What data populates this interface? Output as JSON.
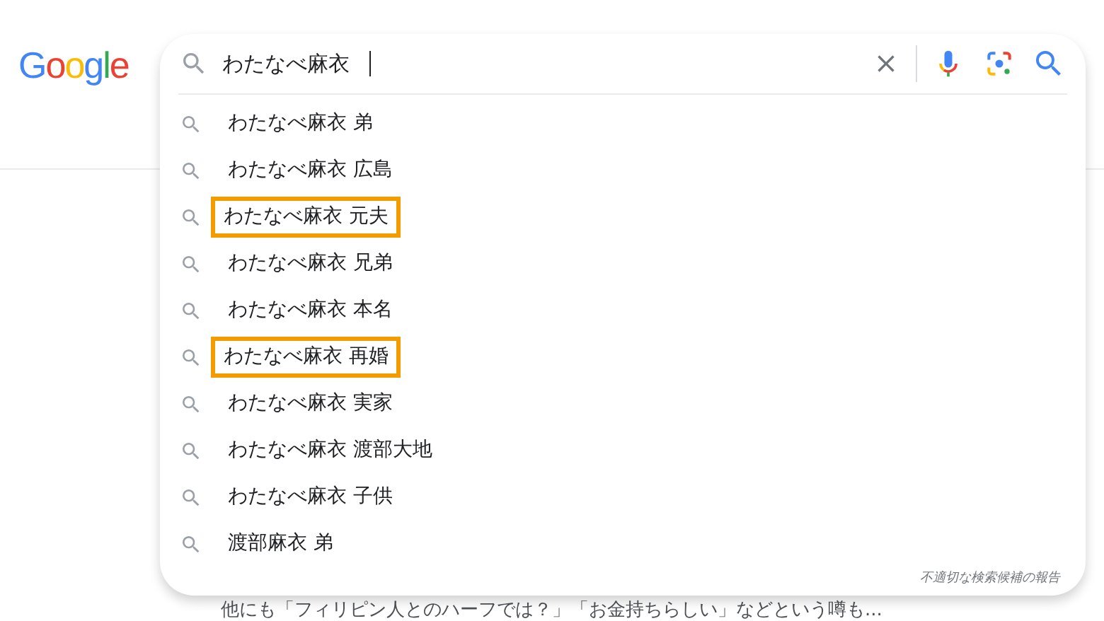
{
  "logo": "Google",
  "search": {
    "value": "わたなべ麻衣"
  },
  "suggestions": [
    {
      "text": "わたなべ麻衣 弟",
      "highlighted": false
    },
    {
      "text": "わたなべ麻衣 広島",
      "highlighted": false
    },
    {
      "text": "わたなべ麻衣 元夫",
      "highlighted": true
    },
    {
      "text": "わたなべ麻衣 兄弟",
      "highlighted": false
    },
    {
      "text": "わたなべ麻衣 本名",
      "highlighted": false
    },
    {
      "text": "わたなべ麻衣 再婚",
      "highlighted": true
    },
    {
      "text": "わたなべ麻衣 実家",
      "highlighted": false
    },
    {
      "text": "わたなべ麻衣 渡部大地",
      "highlighted": false
    },
    {
      "text": "わたなべ麻衣 子供",
      "highlighted": false
    },
    {
      "text": "渡部麻衣 弟",
      "highlighted": false
    }
  ],
  "report_link": "不適切な検索候補の報告",
  "background_snippet": "他にも「フィリピン人とのハーフでは？」「お金持ちらしい」などという噂も..."
}
